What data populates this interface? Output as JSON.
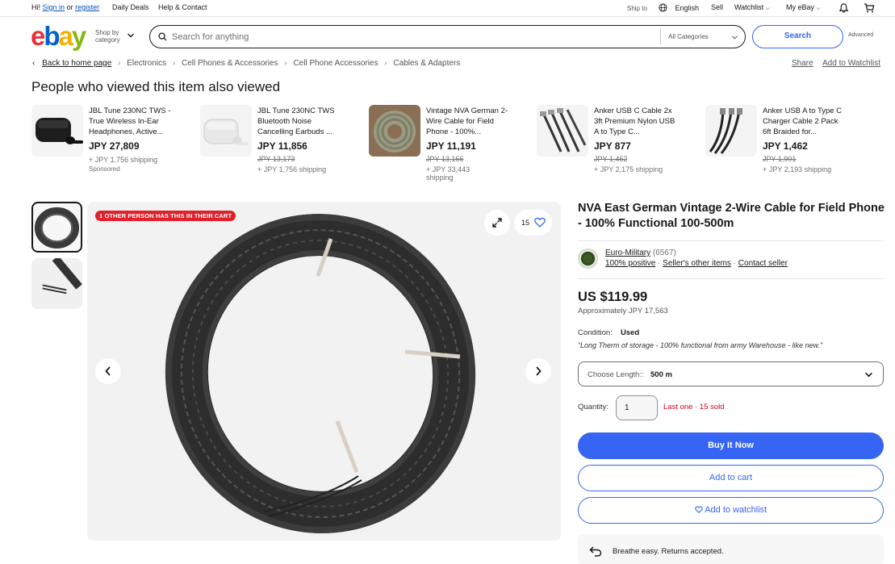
{
  "topbar": {
    "greeting": "Hi!",
    "sign_in": "Sign in",
    "or": "or",
    "register": "register",
    "daily_deals": "Daily Deals",
    "help": "Help & Contact",
    "ship_to": "Ship to",
    "language": "English",
    "sell": "Sell",
    "watchlist": "Watchlist",
    "my_ebay": "My eBay"
  },
  "header": {
    "logo": [
      "e",
      "b",
      "a",
      "y"
    ],
    "logo_colors": [
      "#e53238",
      "#0064d2",
      "#f5af02",
      "#86b817"
    ],
    "shop_by_1": "Shop by",
    "shop_by_2": "category",
    "search_placeholder": "Search for anything",
    "category": "All Categories",
    "search_button": "Search",
    "advanced": "Advanced"
  },
  "breadcrumb": {
    "back": "Back to home page",
    "items": [
      "Electronics",
      "Cell Phones & Accessories",
      "Cell Phone Accessories",
      "Cables & Adapters"
    ],
    "share": "Share",
    "add_watchlist": "Add to Watchlist"
  },
  "also_viewed": {
    "heading": "People who viewed this item also viewed",
    "items": [
      {
        "title": "JBL Tune 230NC TWS - True Wireless In-Ear Headphones, Active...",
        "price": "JPY 27,809",
        "old": "",
        "ship": "+ JPY 1,756 shipping",
        "sponsored": "Sponsored"
      },
      {
        "title": "JBL Tune 230NC TWS Bluetooth Noise Cancelling Earbuds ...",
        "price": "JPY 11,856",
        "old": "JPY 13,173",
        "ship": "+ JPY 1,756 shipping",
        "sponsored": ""
      },
      {
        "title": "Vintage NVA German 2-Wire Cable for Field Phone - 100%...",
        "price": "JPY 11,191",
        "old": "JPY 13,166",
        "ship": "+ JPY 33,443 shipping",
        "sponsored": ""
      },
      {
        "title": "Anker USB C Cable 2x 3ft Premium Nylon USB A to Type C...",
        "price": "JPY 877",
        "old": "JPY 1,462",
        "ship": "+ JPY 2,175 shipping",
        "sponsored": ""
      },
      {
        "title": "Anker USB A to Type C Charger Cable 2 Pack 6ft Braided for...",
        "price": "JPY 1,462",
        "old": "JPY 1,901",
        "ship": "+ JPY 2,193 shipping",
        "sponsored": ""
      }
    ]
  },
  "gallery": {
    "badge": "1 OTHER PERSON HAS THIS IN THEIR CART",
    "watch_count": "15"
  },
  "product": {
    "title": "NVA East German Vintage 2-Wire Cable for Field Phone - 100% Functional 100-500m",
    "seller": "Euro-Military",
    "seller_count": "(6567)",
    "positive": "100% positive",
    "other_items": "Seller's other items",
    "contact": "Contact seller",
    "price": "US $119.99",
    "approx": "Approximately JPY 17,563",
    "condition_label": "Condition:",
    "condition_value": "Used",
    "condition_note": "“Long Therm of storage - 100% functional from army Warehouse - like new.”",
    "length_label": "Choose Length::",
    "length_value": "500 m",
    "quantity_label": "Quantity:",
    "quantity_value": "1",
    "last_one": "Last one",
    "sold": "15 sold",
    "buy_now": "Buy It Now",
    "add_cart": "Add to cart",
    "add_watchlist": "Add to watchlist",
    "breathe": "Breathe easy. Returns accepted."
  }
}
